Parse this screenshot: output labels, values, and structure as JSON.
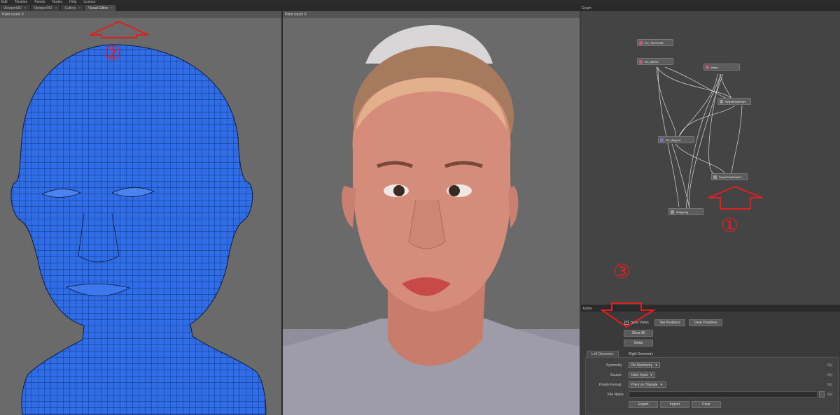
{
  "menu": [
    "Edit",
    "Timeline",
    "Panels",
    "Nodes",
    "Help",
    "License"
  ],
  "tabs": [
    "Viewport3D",
    "Viewport3D",
    "Gallery",
    "Visual Editor"
  ],
  "graph_title": "Graph",
  "viewport1": {
    "header": "Point count: 0"
  },
  "viewport2": {
    "header": "Point count: 0"
  },
  "nodes": {
    "n1": "RC_TEXTURE",
    "n2": "RC_MESH",
    "n3": "Head",
    "n4": "SelectPointPairs",
    "n5": "RC_Aligned",
    "n6": "SelectPointPairs2",
    "n7": "Wrapping"
  },
  "annotations": {
    "a1": "①",
    "a2": "②",
    "a3": "③"
  },
  "editor": {
    "title": "Editor",
    "sync_views": "Sync Views",
    "set_positions": "Set Positions",
    "clear_positions": "Clear Positions",
    "clear_all": "Clear All",
    "swap": "Swap",
    "tab_left": "Left Geometry",
    "tab_right": "Right Geometry",
    "symmetry_label": "Symmetry",
    "symmetry_value": "No Symmetry",
    "source_label": "Source",
    "source_value": "User Input",
    "format_label": "Points Format",
    "format_value": "Point on Triangle",
    "filename_label": "File Name",
    "export": "Export",
    "import": "Import",
    "clear": "Clear",
    "fx": "f(x)"
  },
  "colors": {
    "annotation": "#e02020",
    "mesh": "#2f6de8"
  }
}
